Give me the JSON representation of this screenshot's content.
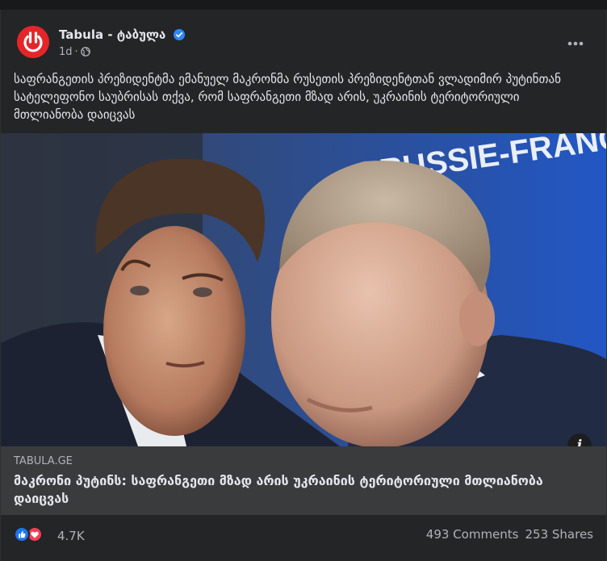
{
  "post": {
    "page_name": "Tabula - ტაბულა",
    "time": "1d",
    "separator": "·",
    "text": "საფრანგეთის პრეზიდენტმა ემანუელ მაკრონმა რუსეთის პრეზიდენტთან ვლადიმირ პუტინთან სატელეფონო საუბრისას თქვა, რომ საფრანგეთი მზად არის, უკრაინის ტერიტორიული მთლიანობა დაიცვას",
    "photo_banner": "RUSSIE-FRANCE",
    "info_label": "i"
  },
  "link_preview": {
    "domain": "TABULA.GE",
    "title": "მაკრონი პუტინს: საფრანგეთი მზად არის უკრაინის ტერიტორიული მთლიანობა დაიცვას"
  },
  "footer": {
    "reaction_count": "4.7K",
    "comments": "493 Comments",
    "shares": "253 Shares"
  },
  "icons": [
    "tabula-logo-icon",
    "verified-badge-icon",
    "globe-icon",
    "more-options-icon",
    "info-icon",
    "like-reaction-icon",
    "love-reaction-icon"
  ],
  "colors": {
    "background": "#18191a",
    "card": "#242526",
    "preview": "#3a3b3c",
    "text_primary": "#e4e6eb",
    "text_secondary": "#b0b3b8",
    "accent_blue": "#2d88ff",
    "logo_red": "#e4262b"
  }
}
